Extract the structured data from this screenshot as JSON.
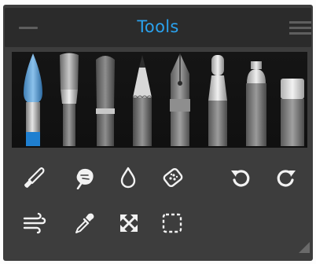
{
  "panel": {
    "title": "Tools"
  },
  "colors": {
    "panel_bg": "#3d3d3d",
    "header_bg": "#2b2b2b",
    "title_accent": "#2aa2ee",
    "tray_bg": "#121212",
    "active_brush_tip": "#1f7fd0",
    "icon": "#f2f2f2"
  },
  "brushes": [
    {
      "name": "round-brush",
      "active": true
    },
    {
      "name": "flat-brush",
      "active": false
    },
    {
      "name": "filbert-brush",
      "active": false
    },
    {
      "name": "pencil",
      "active": false
    },
    {
      "name": "pen",
      "active": false
    },
    {
      "name": "marker",
      "active": false
    },
    {
      "name": "spray-can",
      "active": false
    },
    {
      "name": "eraser",
      "active": false
    }
  ],
  "tool_icons": [
    "knife-icon",
    "smudge-icon",
    "drop-icon",
    "sponge-icon",
    "undo-icon",
    "redo-icon",
    "wind-icon",
    "eyedropper-icon",
    "fit-screen-icon",
    "selection-icon"
  ]
}
